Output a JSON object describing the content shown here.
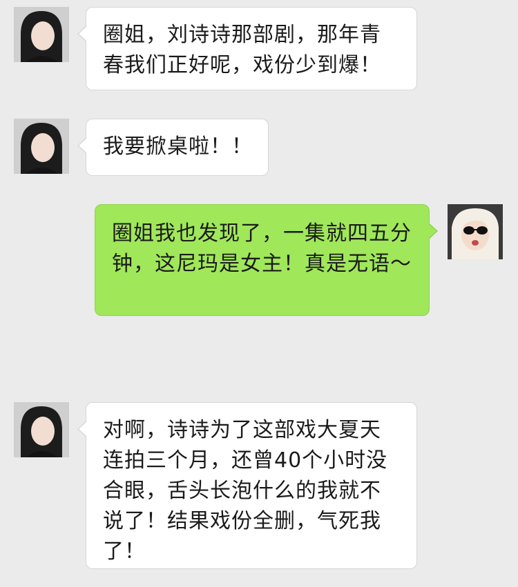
{
  "colors": {
    "background": "#ebebeb",
    "incoming_bubble": "#ffffff",
    "outgoing_bubble": "#a0e75a"
  },
  "messages": [
    {
      "sender": "other",
      "avatar_icon": "avatar-dark-hair-icon",
      "text": "圈姐，刘诗诗那部剧，那年青春我们正好呢，戏份少到爆！"
    },
    {
      "sender": "other",
      "avatar_icon": "avatar-dark-hair-icon",
      "text": "我要掀桌啦！！"
    },
    {
      "sender": "me",
      "avatar_icon": "avatar-blonde-sunglasses-icon",
      "text": "圈姐我也发现了，一集就四五分钟，这尼玛是女主！真是无语～"
    },
    {
      "sender": "other",
      "avatar_icon": "avatar-dark-hair-icon",
      "text": "对啊，诗诗为了这部戏大夏天连拍三个月，还曾40个小时没合眼，舌头长泡什么的我就不说了！结果戏份全删，气死我了！"
    }
  ]
}
